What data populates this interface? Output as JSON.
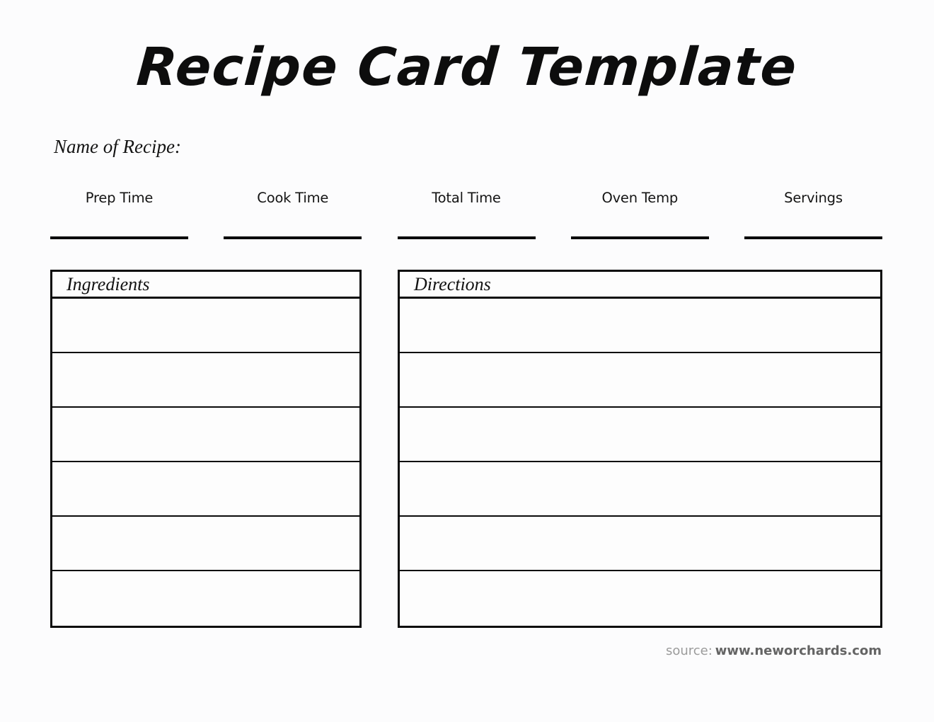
{
  "document": {
    "title": "Recipe Card Template",
    "background_color": "#fcfcfd",
    "ink_color": "#0a0a0a"
  },
  "recipe_name": {
    "label": "Name of Recipe:"
  },
  "meta_fields": [
    {
      "label": "Prep Time",
      "value": ""
    },
    {
      "label": "Cook Time",
      "value": ""
    },
    {
      "label": "Total Time",
      "value": ""
    },
    {
      "label": "Oven Temp",
      "value": ""
    },
    {
      "label": "Servings",
      "value": ""
    }
  ],
  "ingredients_table": {
    "header": "Ingredients",
    "rows": [
      "",
      "",
      "",
      "",
      "",
      ""
    ]
  },
  "directions_table": {
    "header": "Directions",
    "rows": [
      "",
      "",
      "",
      "",
      "",
      ""
    ]
  },
  "source": {
    "prefix": "source:",
    "url": "www.neworchards.com"
  }
}
